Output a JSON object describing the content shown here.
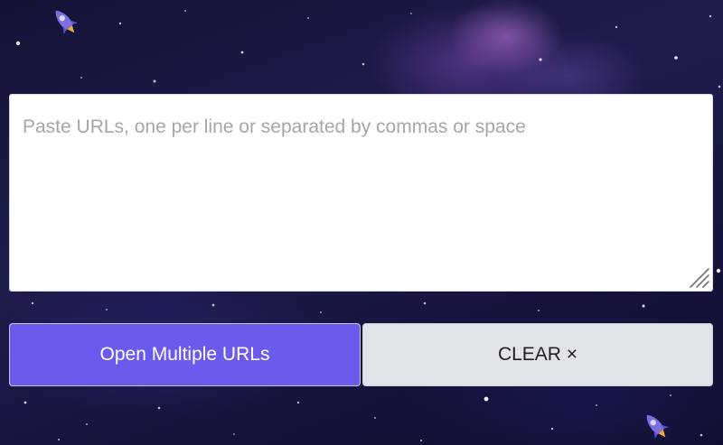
{
  "url_input": {
    "placeholder": "Paste URLs, one per line or separated by commas or space",
    "value": ""
  },
  "buttons": {
    "open_label": "Open Multiple URLs",
    "clear_label": "CLEAR ×"
  },
  "colors": {
    "open_button": "#6a5bec",
    "clear_button": "#e0e4e8",
    "background": "#1f1c4e"
  },
  "icons": {
    "decorations": [
      "rocket-icon",
      "rocket-icon"
    ],
    "textarea_grip": "resize-grip-icon"
  }
}
